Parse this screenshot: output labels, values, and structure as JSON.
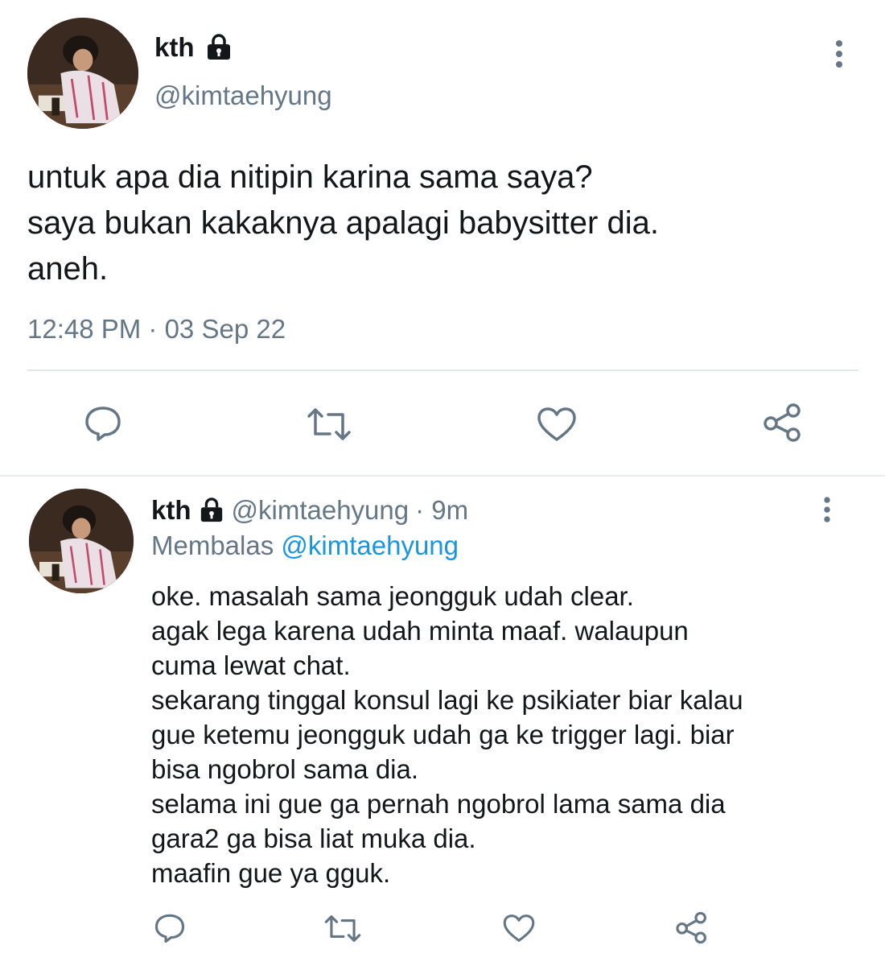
{
  "main_tweet": {
    "display_name": "kth",
    "handle": "@kimtaehyung",
    "text_lines": [
      "untuk apa dia nitipin karina sama saya?",
      "saya bukan kakaknya apalagi babysitter dia.",
      "aneh."
    ],
    "timestamp": "12:48 PM · 03 Sep 22"
  },
  "reply_tweet": {
    "display_name": "kth",
    "handle": "@kimtaehyung",
    "time_ago": "· 9m",
    "replying_label": "Membalas",
    "replying_to": "@kimtaehyung",
    "text_lines": [
      "oke. masalah sama jeongguk udah clear.",
      "agak lega karena udah minta maaf. walaupun",
      "cuma lewat chat.",
      "sekarang tinggal konsul lagi ke psikiater biar kalau",
      "gue ketemu jeongguk udah ga ke trigger lagi. biar",
      "bisa ngobrol sama dia.",
      "selama ini gue ga pernah ngobrol lama sama dia",
      "gara2 ga bisa liat muka dia.",
      "maafin gue ya gguk."
    ]
  },
  "icons": {
    "lock": "lock-icon",
    "more": "more-vertical-icon",
    "reply": "reply-icon",
    "retweet": "retweet-icon",
    "like": "heart-icon",
    "share": "share-icon"
  },
  "colors": {
    "text": "#14171a",
    "secondary": "#657786",
    "link": "#1b95e0",
    "divider": "#e1e8ed"
  }
}
